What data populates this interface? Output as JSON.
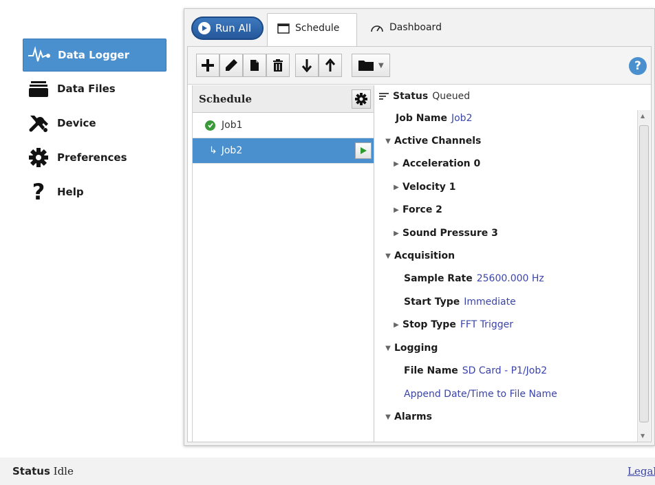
{
  "sidebar": {
    "items": [
      {
        "label": "Data Logger",
        "icon": "waveform-icon",
        "active": true
      },
      {
        "label": "Data Files",
        "icon": "folder-stack-icon"
      },
      {
        "label": "Device",
        "icon": "tools-icon"
      },
      {
        "label": "Preferences",
        "icon": "gear-icon"
      },
      {
        "label": "Help",
        "icon": "question-icon"
      }
    ]
  },
  "tabs": {
    "run_all": "Run All",
    "schedule": "Schedule",
    "dashboard": "Dashboard"
  },
  "toolbar": {
    "buttons": [
      "add-icon",
      "edit-icon",
      "copy-icon",
      "delete-icon",
      "move-down-icon",
      "move-up-icon",
      "folder-icon"
    ],
    "help": "?"
  },
  "schedule": {
    "title": "Schedule",
    "jobs": [
      {
        "name": "Job1",
        "status": "done"
      },
      {
        "name": "Job2",
        "status": "selected"
      }
    ]
  },
  "properties": {
    "status": {
      "label": "Status",
      "value": "Queued"
    },
    "job_name": {
      "label": "Job Name",
      "value": "Job2"
    },
    "active_channels": {
      "label": "Active Channels",
      "channels": [
        "Acceleration 0",
        "Velocity 1",
        "Force 2",
        "Sound Pressure 3"
      ]
    },
    "acquisition": {
      "label": "Acquisition",
      "sample_rate": {
        "label": "Sample Rate",
        "value": "25600.000 Hz"
      },
      "start_type": {
        "label": "Start Type",
        "value": "Immediate"
      },
      "stop_type": {
        "label": "Stop Type",
        "value": "FFT Trigger"
      }
    },
    "logging": {
      "label": "Logging",
      "file_name": {
        "label": "File Name",
        "value": "SD Card - P1/Job2"
      },
      "append": "Append Date/Time to File Name"
    },
    "alarms": {
      "label": "Alarms"
    }
  },
  "statusbar": {
    "label": "Status",
    "value": "Idle",
    "legal": "Legal"
  },
  "colors": {
    "accent": "#4a90cf",
    "value_text": "#3a44a8",
    "ok_green": "#3a9a3a"
  }
}
